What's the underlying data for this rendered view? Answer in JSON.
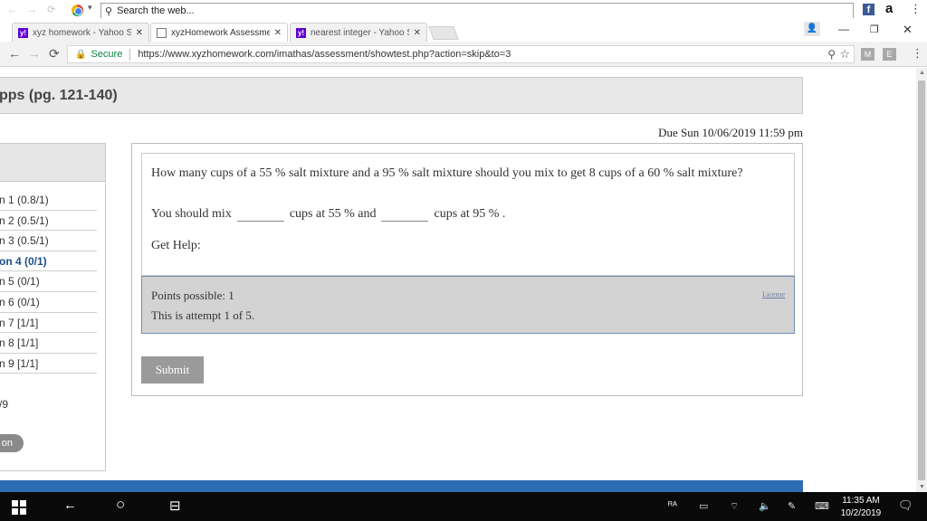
{
  "top_strip": {
    "search_text": "Search the web...",
    "fb_glyph": "f",
    "amazon_glyph": "a"
  },
  "tabs": [
    {
      "label": "xyz homework - Yahoo S",
      "favicon": "yahoo",
      "fav_glyph": "y!"
    },
    {
      "label": "xyzHomework Assessme",
      "favicon": "page",
      "fav_glyph": ""
    },
    {
      "label": "nearest integer - Yahoo S",
      "favicon": "yahoo",
      "fav_glyph": "y!"
    }
  ],
  "address": {
    "secure_label": "Secure",
    "url": "https://www.xyzhomework.com/imathas/assessment/showtest.php?action=skip&to=3"
  },
  "extensions": [
    "M",
    "E"
  ],
  "page": {
    "title": "pps (pg. 121-140)",
    "due": "Due Sun 10/06/2019 11:59 pm",
    "sidebar_items": [
      {
        "label": "n 1 (0.8/1)",
        "current": false
      },
      {
        "label": "n 2 (0.5/1)",
        "current": false
      },
      {
        "label": "n 3 (0.5/1)",
        "current": false
      },
      {
        "label": "on 4 (0/1)",
        "current": true
      },
      {
        "label": "n 5 (0/1)",
        "current": false
      },
      {
        "label": "n 6 (0/1)",
        "current": false
      },
      {
        "label": "n 7 [1/1]",
        "current": false
      },
      {
        "label": "n 8 [1/1]",
        "current": false
      },
      {
        "label": "n 9 [1/1]",
        "current": false
      }
    ],
    "sidebar_count": "/9",
    "sidebar_button": "on",
    "question": {
      "text": "How many cups of a 55 %  salt mixture and a 95 %  salt mixture should you mix to get 8 cups of a 60 %  salt mixture?",
      "answer_prefix": "You should mix",
      "answer_mid": "cups at 55 %  and",
      "answer_suffix": "cups at 95 % .",
      "get_help": "Get Help:"
    },
    "points": "Points possible: 1",
    "attempt": "This is attempt 1 of 5.",
    "license": "License",
    "submit": "Submit"
  },
  "taskbar": {
    "time": "11:35 AM",
    "date": "10/2/2019"
  },
  "colors": {
    "accent_blue": "#2e6db4",
    "secure_green": "#0b8043",
    "current_item": "#1a4f8a"
  }
}
